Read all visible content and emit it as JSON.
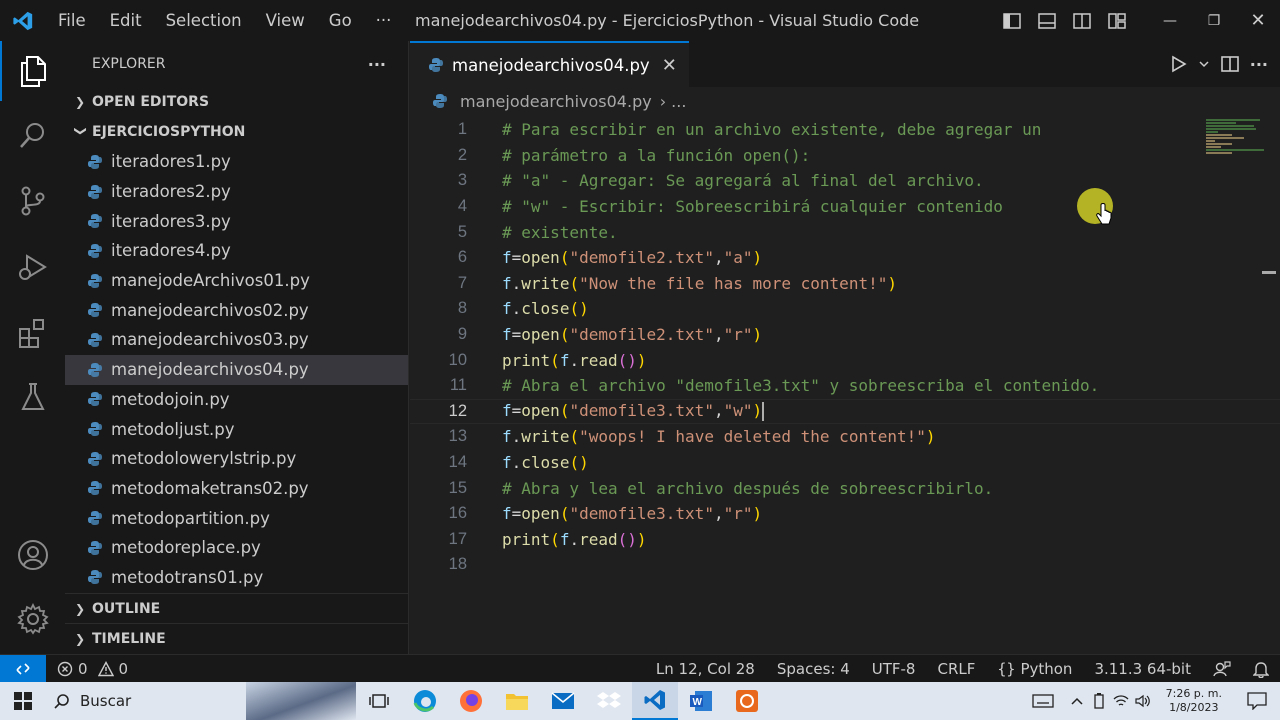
{
  "titlebar": {
    "menu": [
      "File",
      "Edit",
      "Selection",
      "View",
      "Go",
      "···"
    ],
    "title": "manejodearchivos04.py - EjerciciosPython - Visual Studio Code"
  },
  "explorer": {
    "header": "EXPLORER",
    "more": "···",
    "open_editors": "OPEN EDITORS",
    "folder": "EJERCICIOSPYTHON",
    "files": [
      "iteradores1.py",
      "iteradores2.py",
      "iteradores3.py",
      "iteradores4.py",
      "manejodeArchivos01.py",
      "manejodearchivos02.py",
      "manejodearchivos03.py",
      "manejodearchivos04.py",
      "metodojoin.py",
      "metodoljust.py",
      "metodolowerylstrip.py",
      "metodomaketrans02.py",
      "metodopartition.py",
      "metodoreplace.py",
      "metodotrans01.py"
    ],
    "selected_file": "manejodearchivos04.py",
    "outline": "OUTLINE",
    "timeline": "TIMELINE"
  },
  "editor": {
    "tab_label": "manejodearchivos04.py",
    "breadcrumb_file": "manejodearchivos04.py",
    "breadcrumb_more": "› ...",
    "current_line": 12,
    "lines": [
      "# Para escribir en un archivo existente, debe agregar un",
      "# parámetro a la función open():",
      "# \"a\" - Agregar: Se agregará al final del archivo.",
      "# \"w\" - Escribir: Sobreescribirá cualquier contenido",
      "# existente.",
      "f=open(\"demofile2.txt\",\"a\")",
      "f.write(\"Now the file has more content!\")",
      "f.close()",
      "f=open(\"demofile2.txt\",\"r\")",
      "print(f.read())",
      "# Abra el archivo \"demofile3.txt\" y sobreescriba el contenido.",
      "f=open(\"demofile3.txt\",\"w\")",
      "f.write(\"woops! I have deleted the content!\")",
      "f.close()",
      "# Abra y lea el archivo después de sobreescribirlo.",
      "f=open(\"demofile3.txt\",\"r\")",
      "print(f.read())",
      ""
    ]
  },
  "statusbar": {
    "errors": "0",
    "warnings": "0",
    "position": "Ln 12, Col 28",
    "spaces": "Spaces: 4",
    "encoding": "UTF-8",
    "eol": "CRLF",
    "language": "Python",
    "interpreter": "3.11.3 64-bit"
  },
  "taskbar": {
    "search": "Buscar",
    "time": "7:26 p. m.",
    "date": "1/8/2023"
  },
  "colors": {
    "accent": "#0078d4",
    "comment": "#6a9955",
    "string": "#ce9178",
    "function": "#dcdcaa"
  }
}
